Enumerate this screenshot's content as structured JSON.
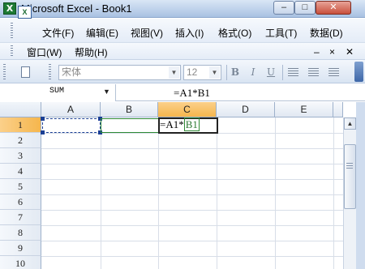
{
  "window": {
    "title": "Microsoft Excel - Book1",
    "minimize_glyph": "–",
    "maximize_glyph": "□",
    "close_glyph": "✕",
    "icon_letter": "X"
  },
  "menu": {
    "items": [
      "文件(F)",
      "编辑(E)",
      "视图(V)",
      "插入(I)",
      "格式(O)",
      "工具(T)",
      "数据(D)"
    ],
    "row2": [
      "窗口(W)",
      "帮助(H)"
    ],
    "mdi_minimize": "–",
    "mdi_restore": "×",
    "mdi_close": "✕"
  },
  "toolbar": {
    "font_name": "宋体",
    "font_size": "12",
    "bold": "B",
    "italic": "I",
    "underline": "U",
    "icons": [
      "new-doc-icon",
      "align-left-icon",
      "align-center-icon",
      "align-right-icon"
    ]
  },
  "formula_bar": {
    "name_box": "SUM",
    "formula": "=A1*B1"
  },
  "sheet": {
    "columns": [
      "A",
      "B",
      "C",
      "D",
      "E"
    ],
    "rows": [
      "1",
      "2",
      "3",
      "4",
      "5",
      "6",
      "7",
      "8",
      "9",
      "10"
    ],
    "active_cell": "C1",
    "c1_prefix": "=A1*",
    "c1_ref": "B1"
  },
  "colors": {
    "active_header": "#f5b64d",
    "ref_a1": "#1b3f94",
    "ref_b1": "#2f8a35"
  }
}
